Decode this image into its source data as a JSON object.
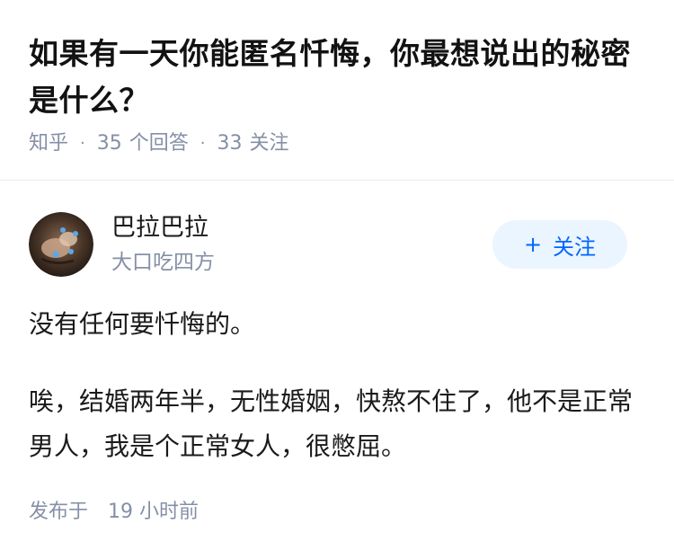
{
  "question": {
    "title": "如果有一天你能匿名忏悔，你最想说出的秘密是什么？",
    "source": "知乎",
    "answers_count": "35",
    "answers_label": "个回答",
    "followers_count": "33",
    "followers_label": "关注",
    "separator": "·"
  },
  "author": {
    "name": "巴拉巴拉",
    "bio": "大口吃四方",
    "avatar_icon": "avatar-image",
    "follow_label": "关注",
    "follow_icon": "plus-icon",
    "accent_color": "#0066ff"
  },
  "answer": {
    "paragraphs": [
      "没有任何要忏悔的。",
      "唉，结婚两年半，无性婚姻，快熬不住了，他不是正常男人，我是个正常女人，很憋屈。"
    ]
  },
  "footer": {
    "published_label": "发布于",
    "published_time": "19 小时前"
  }
}
